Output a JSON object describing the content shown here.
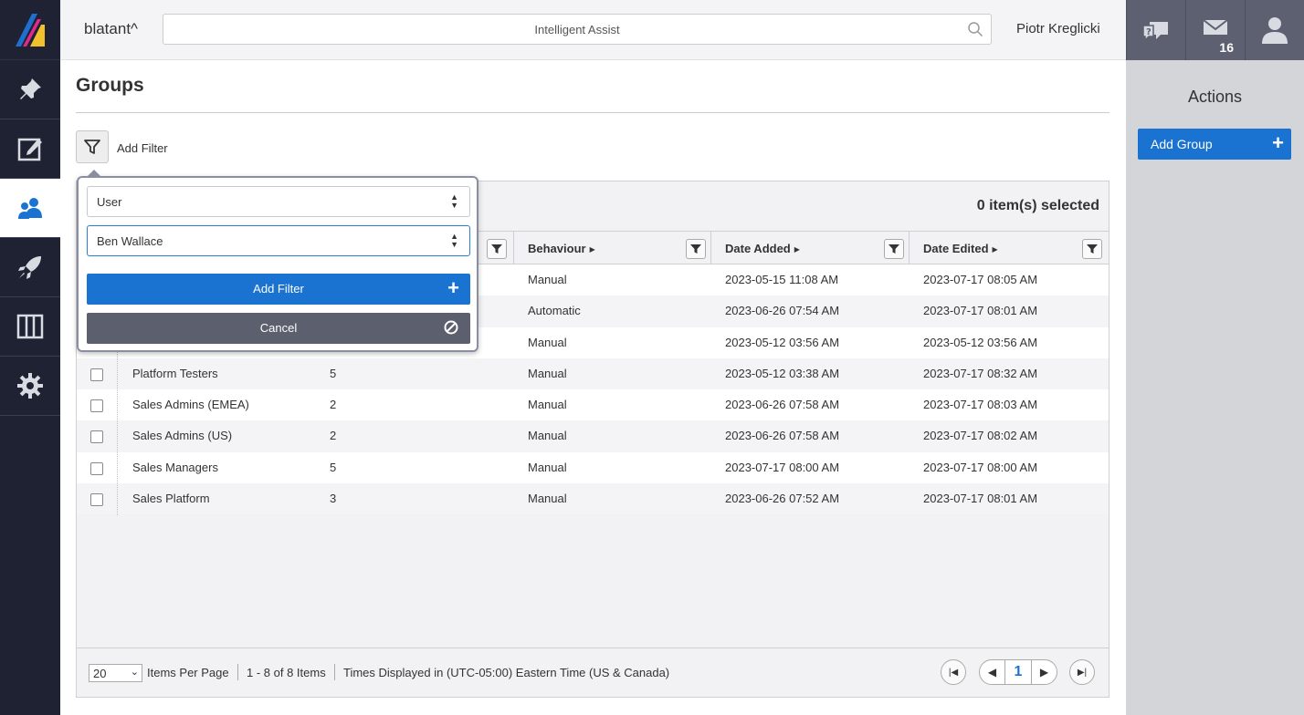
{
  "brand": "blatant^",
  "search": {
    "placeholder": "Intelligent Assist"
  },
  "user": {
    "name": "Piotr Kreglicki"
  },
  "notifications": {
    "mail_count": "16"
  },
  "page": {
    "title": "Groups",
    "add_filter_label": "Add Filter"
  },
  "actions": {
    "title": "Actions",
    "add_group_label": "Add Group"
  },
  "grid": {
    "selected_count": "0 item(s) selected",
    "columns": {
      "behaviour": "Behaviour",
      "date_added": "Date Added",
      "date_edited": "Date Edited"
    },
    "rows": [
      {
        "name": "",
        "count": "",
        "behaviour": "Manual",
        "date_added": "2023-05-15 11:08 AM",
        "date_edited": "2023-07-17 08:05 AM"
      },
      {
        "name": "",
        "count": "",
        "behaviour": "Automatic",
        "date_added": "2023-06-26 07:54 AM",
        "date_edited": "2023-07-17 08:01 AM"
      },
      {
        "name": "",
        "count": "",
        "behaviour": "Manual",
        "date_added": "2023-05-12 03:56 AM",
        "date_edited": "2023-05-12 03:56 AM"
      },
      {
        "name": "Platform Testers",
        "count": "5",
        "behaviour": "Manual",
        "date_added": "2023-05-12 03:38 AM",
        "date_edited": "2023-07-17 08:32 AM"
      },
      {
        "name": "Sales Admins (EMEA)",
        "count": "2",
        "behaviour": "Manual",
        "date_added": "2023-06-26 07:58 AM",
        "date_edited": "2023-07-17 08:03 AM"
      },
      {
        "name": "Sales Admins (US)",
        "count": "2",
        "behaviour": "Manual",
        "date_added": "2023-06-26 07:58 AM",
        "date_edited": "2023-07-17 08:02 AM"
      },
      {
        "name": "Sales Managers",
        "count": "5",
        "behaviour": "Manual",
        "date_added": "2023-07-17 08:00 AM",
        "date_edited": "2023-07-17 08:00 AM"
      },
      {
        "name": "Sales Platform",
        "count": "3",
        "behaviour": "Manual",
        "date_added": "2023-06-26 07:52 AM",
        "date_edited": "2023-07-17 08:01 AM"
      }
    ],
    "footer": {
      "items_per_page_value": "20",
      "items_per_page_label": "Items Per Page",
      "range": "1 - 8 of 8 Items",
      "timezone": "Times Displayed in (UTC-05:00) Eastern Time (US & Canada)",
      "current_page": "1"
    }
  },
  "filter_popup": {
    "field_value": "User",
    "value_value": "Ben Wallace",
    "add_label": "Add Filter",
    "cancel_label": "Cancel"
  },
  "colors": {
    "accent": "#1a73d1",
    "sidebar": "#1f2233",
    "cancel": "#5b5f6e"
  }
}
